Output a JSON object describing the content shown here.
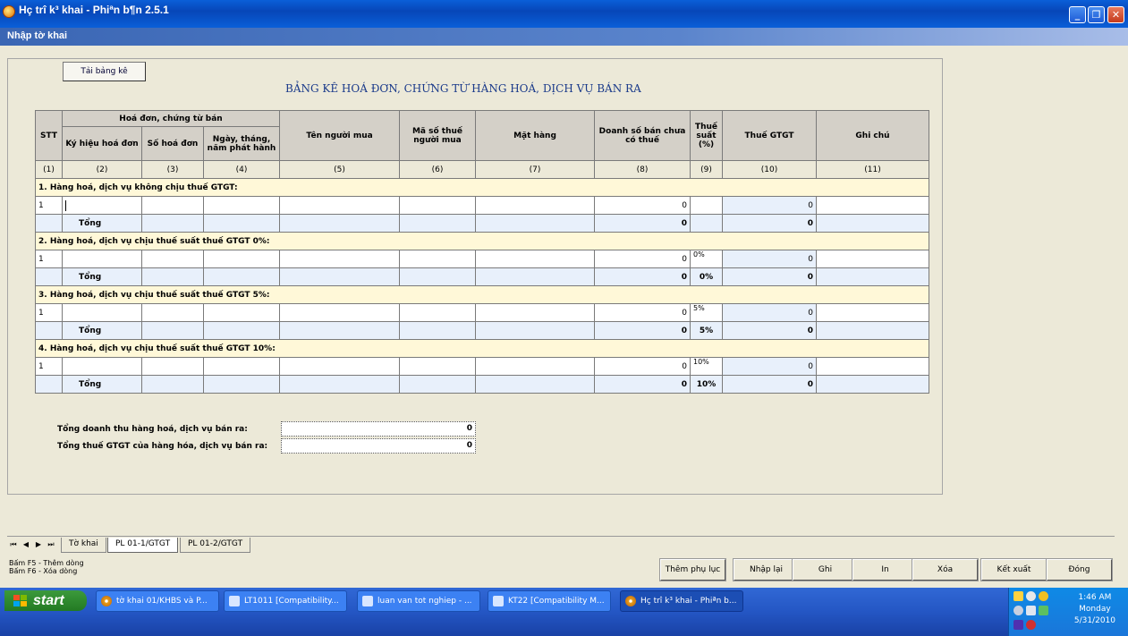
{
  "window": {
    "title": "Hç trî k³ khai - Phiªn b¶n 2.5.1",
    "menu": "Nhập tờ khai"
  },
  "toolbar": {
    "load_button": "Tải bảng kê"
  },
  "heading": "BẢNG KÊ HOÁ ĐƠN, CHỨNG TỪ HÀNG HOÁ, DỊCH VỤ BÁN RA",
  "table": {
    "headers": {
      "stt": "STT",
      "invoice_group": "Hoá đơn, chứng từ bán",
      "symbol": "Ký hiệu hoá đơn",
      "number": "Số hoá đơn",
      "date": "Ngày, tháng, năm phát hành",
      "buyer": "Tên người mua",
      "tax_code": "Mã số thuế người mua",
      "item": "Mặt hàng",
      "revenue": "Doanh số bán chưa có thuế",
      "rate": "Thuế suất (%)",
      "vat": "Thuế GTGT",
      "note": "Ghi chú"
    },
    "col_numbers": [
      "(1)",
      "(2)",
      "(3)",
      "(4)",
      "(5)",
      "(6)",
      "(7)",
      "(8)",
      "(9)",
      "(10)",
      "(11)"
    ],
    "sections": [
      {
        "title": "1. Hàng hoá, dịch vụ không chịu thuế GTGT:",
        "row_stt": "1",
        "revenue": "0",
        "rate": "",
        "vat": "0",
        "total_label": "Tổng",
        "total_revenue": "0",
        "total_rate": "",
        "total_vat": "0"
      },
      {
        "title": "2. Hàng hoá, dịch vụ chịu thuế suất thuế GTGT 0%:",
        "row_stt": "1",
        "revenue": "0",
        "rate": "0%",
        "vat": "0",
        "total_label": "Tổng",
        "total_revenue": "0",
        "total_rate": "0%",
        "total_vat": "0"
      },
      {
        "title": "3. Hàng hoá, dịch vụ chịu thuế suất thuế GTGT 5%:",
        "row_stt": "1",
        "revenue": "0",
        "rate": "5%",
        "vat": "0",
        "total_label": "Tổng",
        "total_revenue": "0",
        "total_rate": "5%",
        "total_vat": "0"
      },
      {
        "title": "4. Hàng hoá, dịch vụ chịu thuế suất thuế GTGT 10%:",
        "row_stt": "1",
        "revenue": "0",
        "rate": "10%",
        "vat": "0",
        "total_label": "Tổng",
        "total_revenue": "0",
        "total_rate": "10%",
        "total_vat": "0"
      }
    ]
  },
  "summary": {
    "total_revenue_label": "Tổng doanh thu hàng hoá, dịch vụ bán ra:",
    "total_revenue_value": "0",
    "total_vat_label": "Tổng thuế GTGT của hàng hóa, dịch vụ bán ra:",
    "total_vat_value": "0"
  },
  "sheet_tabs": [
    "Tờ khai",
    "PL 01-1/GTGT",
    "PL 01-2/GTGT"
  ],
  "hints": [
    "Bấm F5 - Thêm dòng",
    "Bấm F6 - Xóa dòng"
  ],
  "buttons": {
    "add_appendix": "Thêm phụ lục",
    "reenter": "Nhập lại",
    "save": "Ghi",
    "print": "In",
    "delete": "Xóa",
    "export": "Kết xuất",
    "close": "Đóng"
  },
  "taskbar": {
    "start": "start",
    "tasks": [
      "tờ khai 01/KHBS và P...",
      "LT1011 [Compatibility...",
      "luan van tot nghiep - ...",
      "KT22 [Compatibility M...",
      "Hç trî k³ khai - Phiªn b..."
    ],
    "clock_time": "1:46 AM",
    "clock_day": "Monday",
    "clock_date": "5/31/2010"
  },
  "colors": {
    "titlebar": "#0a5fd8",
    "heading": "#1a3a8a",
    "section_bg": "#fff8d8",
    "total_bg": "#e8f0fb",
    "taskbar": "#2456c4",
    "start": "#2f8a2f"
  }
}
